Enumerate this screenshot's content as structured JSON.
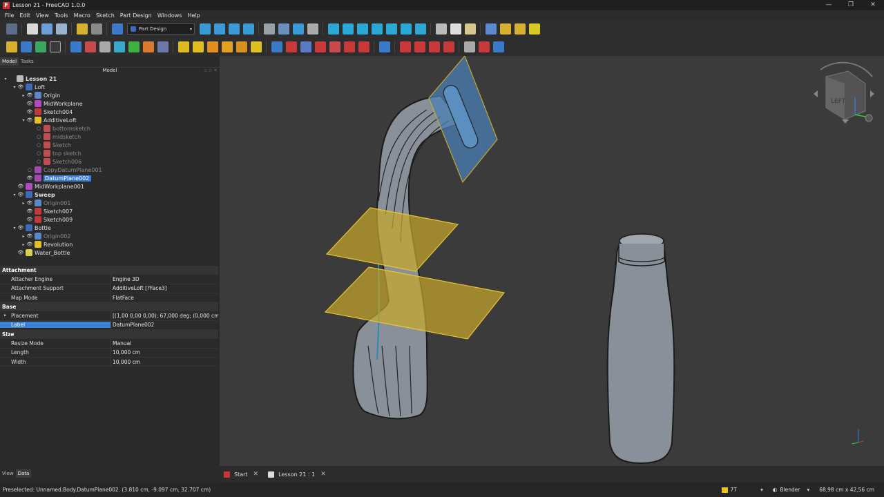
{
  "window": {
    "title": "Lesson 21 - FreeCAD 1.0.0"
  },
  "menu": [
    "File",
    "Edit",
    "View",
    "Tools",
    "Macro",
    "Sketch",
    "Part Design",
    "Windows",
    "Help"
  ],
  "workbench": {
    "selected": "Part Design"
  },
  "combo": {
    "tabs": [
      "Model",
      "Tasks"
    ],
    "header": "Model"
  },
  "tree": [
    {
      "label": "Lesson 21",
      "indent": 0,
      "arrow": "▾",
      "eye": "",
      "icon": "#bbbbbb",
      "style": "bold"
    },
    {
      "label": "Loft",
      "indent": 1,
      "arrow": "▾",
      "eye": "👁",
      "icon": "#3b6ab8",
      "style": ""
    },
    {
      "label": "Origin",
      "indent": 2,
      "arrow": "▸",
      "eye": "👁",
      "icon": "#5a88c9",
      "style": ""
    },
    {
      "label": "MidWorkplane",
      "indent": 2,
      "arrow": "",
      "eye": "👁",
      "icon": "#b04ac0",
      "style": ""
    },
    {
      "label": "Sketch004",
      "indent": 2,
      "arrow": "",
      "eye": "👁",
      "icon": "#c03a3a",
      "style": ""
    },
    {
      "label": "AdditiveLoft",
      "indent": 2,
      "arrow": "▾",
      "eye": "👁",
      "icon": "#e0c020",
      "style": ""
    },
    {
      "label": "bottomsketch",
      "indent": 3,
      "arrow": "",
      "eye": "◌",
      "icon": "#c05050",
      "style": "dim"
    },
    {
      "label": "midsketch",
      "indent": 3,
      "arrow": "",
      "eye": "◌",
      "icon": "#c05050",
      "style": "dim"
    },
    {
      "label": "Sketch",
      "indent": 3,
      "arrow": "",
      "eye": "◌",
      "icon": "#c05050",
      "style": "dim"
    },
    {
      "label": "top sketch",
      "indent": 3,
      "arrow": "",
      "eye": "◌",
      "icon": "#c05050",
      "style": "dim"
    },
    {
      "label": "Sketch006",
      "indent": 3,
      "arrow": "",
      "eye": "◌",
      "icon": "#c05050",
      "style": "dim"
    },
    {
      "label": "CopyDatumPlane001",
      "indent": 2,
      "arrow": "",
      "eye": "◌",
      "icon": "#a04ab0",
      "style": "dim"
    },
    {
      "label": "DatumPlane002",
      "indent": 2,
      "arrow": "",
      "eye": "👁",
      "icon": "#a04ab0",
      "style": "hl"
    },
    {
      "label": "MidWorkplane001",
      "indent": 1,
      "arrow": "",
      "eye": "👁",
      "icon": "#b04ac0",
      "style": ""
    },
    {
      "label": "Sweep",
      "indent": 1,
      "arrow": "▾",
      "eye": "👁",
      "icon": "#3b6ab8",
      "style": "bold"
    },
    {
      "label": "Origin001",
      "indent": 2,
      "arrow": "▸",
      "eye": "👁",
      "icon": "#5a88c9",
      "style": "dim"
    },
    {
      "label": "Sketch007",
      "indent": 2,
      "arrow": "",
      "eye": "👁",
      "icon": "#c03a3a",
      "style": ""
    },
    {
      "label": "Sketch009",
      "indent": 2,
      "arrow": "",
      "eye": "👁",
      "icon": "#c03a3a",
      "style": ""
    },
    {
      "label": "Bottle",
      "indent": 1,
      "arrow": "▾",
      "eye": "👁",
      "icon": "#3b6ab8",
      "style": ""
    },
    {
      "label": "Origin002",
      "indent": 2,
      "arrow": "▸",
      "eye": "👁",
      "icon": "#5a88c9",
      "style": "dim"
    },
    {
      "label": "Revolution",
      "indent": 2,
      "arrow": "▸",
      "eye": "👁",
      "icon": "#e0c020",
      "style": ""
    },
    {
      "label": "Water_Bottle",
      "indent": 1,
      "arrow": "",
      "eye": "👁",
      "icon": "#d8d050",
      "style": ""
    }
  ],
  "properties": [
    {
      "type": "group",
      "label": "Attachment"
    },
    {
      "type": "prop",
      "key": "Attacher Engine",
      "value": "Engine 3D"
    },
    {
      "type": "prop",
      "key": "Attachment Support",
      "value": "AdditiveLoft [?Face3]"
    },
    {
      "type": "prop",
      "key": "Map Mode",
      "value": "FlatFace"
    },
    {
      "type": "group",
      "label": "Base"
    },
    {
      "type": "prop",
      "key": "Placement",
      "value": "[(1,00 0,00 0,00); 67,000 deg; (0,000 cm  -8...",
      "expand": "▸"
    },
    {
      "type": "prop",
      "key": "Label",
      "value": "DatumPlane002",
      "selected": true
    },
    {
      "type": "group",
      "label": "Size"
    },
    {
      "type": "prop",
      "key": "Resize Mode",
      "value": "Manual"
    },
    {
      "type": "prop",
      "key": "Length",
      "value": "10,000 cm"
    },
    {
      "type": "prop",
      "key": "Width",
      "value": "10,000 cm"
    }
  ],
  "bottom_tabs": [
    "View",
    "Data"
  ],
  "navcube": {
    "face": "LEFT"
  },
  "doc_tabs": [
    "Start",
    "Lesson 21 : 1"
  ],
  "status": {
    "message": "Preselected: Unnamed.Body.DatumPlane002. (3.810 cm, -9.097 cm, 32.707 cm)",
    "count": "77",
    "nav_style": "Blender",
    "dimensions": "68,98 cm x 42,56 cm"
  },
  "colors": {
    "accent": "#3a80d6",
    "plane_yellow": "#c9a82a",
    "plane_blue": "#4a7fb5",
    "body": "#8a9099"
  }
}
